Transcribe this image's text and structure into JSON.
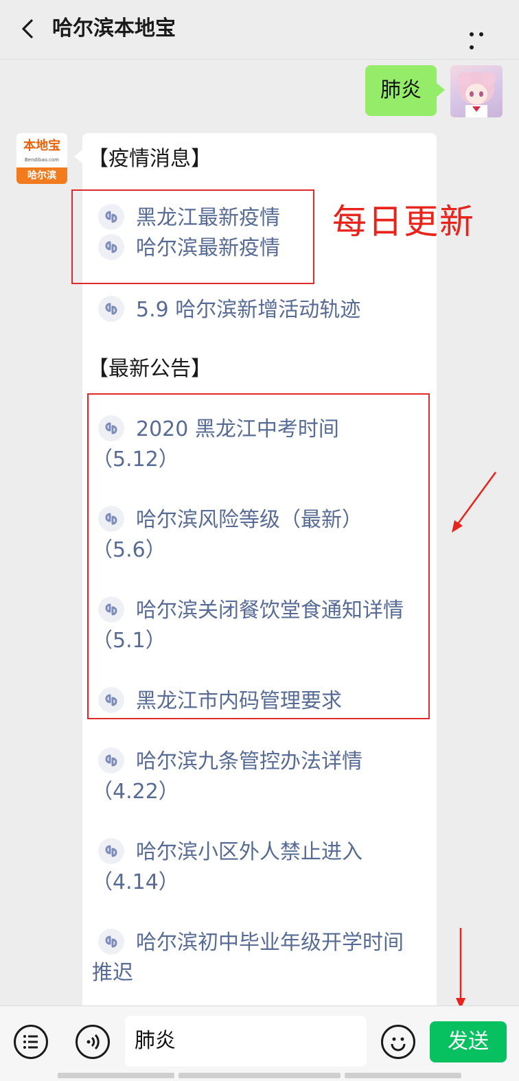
{
  "header": {
    "title": "哈尔滨本地宝"
  },
  "me": {
    "message": "肺炎"
  },
  "bot": {
    "avatar": {
      "logo": "本地宝",
      "domain": "Bendibao.com",
      "city": "哈尔滨"
    },
    "sections": [
      {
        "heading": "【疫情消息】"
      },
      {
        "heading": "【最新公告】"
      }
    ],
    "links": [
      {
        "text": "黑龙江最新疫情"
      },
      {
        "text": "哈尔滨最新疫情"
      },
      {
        "text": "5.9 哈尔滨新增活动轨迹"
      },
      {
        "text": "2020 黑龙江中考时间",
        "date": "（5.12）"
      },
      {
        "text": "哈尔滨风险等级（最新）",
        "date": "（5.6）"
      },
      {
        "text": "哈尔滨关闭餐饮堂食通知详情",
        "date": "（5.1）"
      },
      {
        "text": "黑龙江市内码管理要求"
      },
      {
        "text": "哈尔滨九条管控办法详情",
        "date": "（4.22）"
      },
      {
        "text": "哈尔滨小区外人禁止进入",
        "date": "（4.14）"
      },
      {
        "text": "哈尔滨初中毕业年级开学时间",
        "date": "推迟"
      }
    ]
  },
  "annotation": {
    "note": "每日更新",
    "color": "#e8231b"
  },
  "input": {
    "value": "肺炎",
    "send_label": "发送"
  },
  "colors": {
    "send": "#07c160",
    "bubble_me": "#95ec69",
    "link": "#576b95"
  }
}
